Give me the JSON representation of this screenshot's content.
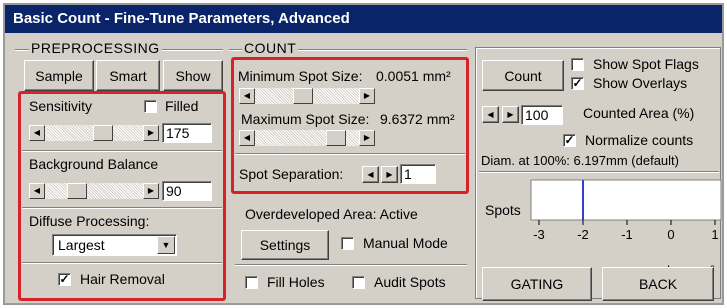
{
  "window": {
    "title": "Basic Count - Fine-Tune Parameters, Advanced"
  },
  "preprocessing": {
    "group_title": "PREPROCESSING",
    "buttons": {
      "sample": "Sample",
      "smart": "Smart",
      "show": "Show"
    },
    "sensitivity": {
      "label": "Sensitivity",
      "filled_label": "Filled",
      "filled_checked": false,
      "value": "175",
      "level": 0.62
    },
    "background_balance": {
      "label": "Background Balance",
      "value": "90",
      "level": 0.28
    },
    "diffuse_processing": {
      "label": "Diffuse Processing:",
      "selected": "Largest"
    },
    "hair_removal": {
      "label": "Hair Removal",
      "checked": true
    }
  },
  "count": {
    "group_title": "COUNT",
    "min_spot_size": {
      "label": "Minimum Spot Size:",
      "value": "0.0051 mm²",
      "level": 0.45
    },
    "max_spot_size": {
      "label": "Maximum Spot Size:",
      "value": "9.6372 mm²",
      "level": 0.85
    },
    "spot_separation": {
      "label": "Spot Separation:",
      "value": "1"
    },
    "overdeveloped": {
      "label": "Overdeveloped Area: Active",
      "settings_button": "Settings",
      "manual_mode_label": "Manual Mode",
      "manual_mode_checked": false
    },
    "fill_holes": {
      "label": "Fill Holes",
      "checked": false
    },
    "audit_spots": {
      "label": "Audit Spots",
      "checked": false
    }
  },
  "right_panel": {
    "count_button": "Count",
    "show_spot_flags": {
      "label": "Show Spot Flags",
      "checked": false
    },
    "show_overlays": {
      "label": "Show Overlays",
      "checked": true
    },
    "counted_area": {
      "value": "100",
      "label": "Counted Area (%)"
    },
    "normalize_counts": {
      "label": "Normalize counts",
      "checked": true
    },
    "diameter_text": "Diam. at 100%: 6.197mm  (default)",
    "spots_chart": {
      "label": "Spots",
      "ticks": [
        "-3",
        "-2",
        "-1",
        "0",
        "1"
      ],
      "axis_unit": "Log mm²",
      "marker_value": -2
    },
    "gating_button": "GATING",
    "back_button": "BACK"
  },
  "colors": {
    "title_bar": "#0a246a",
    "highlight": "#d8222a",
    "marker": "#2f3fd0"
  }
}
